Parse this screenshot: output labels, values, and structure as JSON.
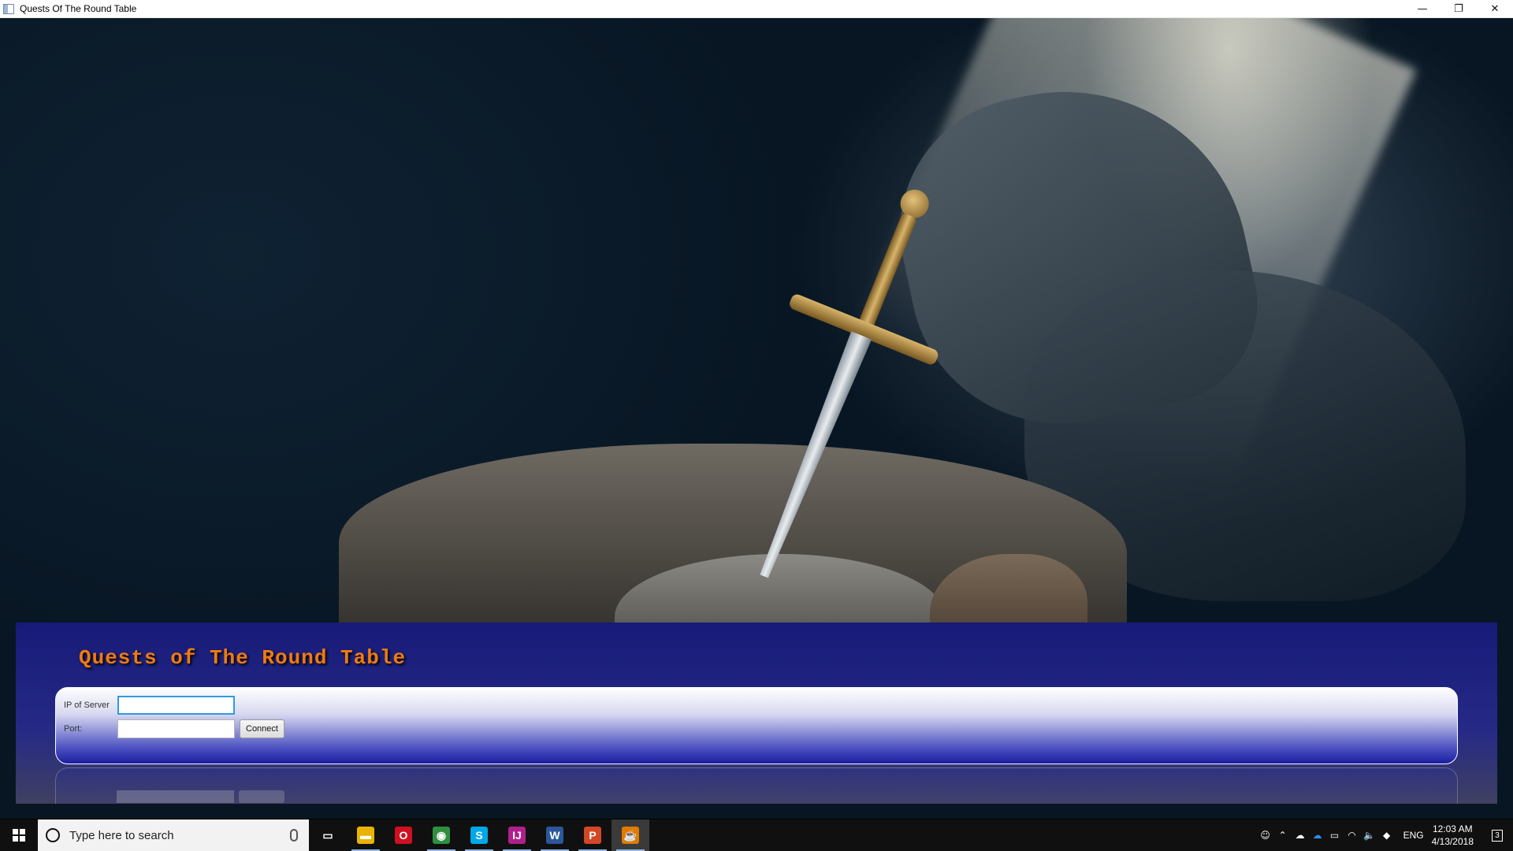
{
  "window": {
    "title": "Quests Of The Round Table",
    "controls": {
      "minimize": "—",
      "restore": "❐",
      "close": "✕"
    }
  },
  "game": {
    "title": "Quests of The Round Table",
    "ip_label": "IP of Server",
    "ip_value": "",
    "port_label": "Port:",
    "port_value": "",
    "connect_label": "Connect",
    "accent_color": "#f07a10",
    "panel_color": "#171a78"
  },
  "taskbar": {
    "search_placeholder": "Type here to search",
    "apps": [
      {
        "name": "task-view-icon",
        "glyph": "▭",
        "color": "#101010",
        "active": false
      },
      {
        "name": "file-explorer-icon",
        "glyph": "▬",
        "color": "#e8b400",
        "active": true
      },
      {
        "name": "opera-icon",
        "glyph": "O",
        "color": "#d01020",
        "active": false
      },
      {
        "name": "chrome-icon",
        "glyph": "◉",
        "color": "#2f8f3f",
        "active": true
      },
      {
        "name": "skype-icon",
        "glyph": "S",
        "color": "#00a8e8",
        "active": true
      },
      {
        "name": "intellij-icon",
        "glyph": "IJ",
        "color": "#b0208a",
        "active": true
      },
      {
        "name": "word-icon",
        "glyph": "W",
        "color": "#2b579a",
        "active": true
      },
      {
        "name": "powerpoint-icon",
        "glyph": "P",
        "color": "#d24726",
        "active": true
      },
      {
        "name": "java-icon",
        "glyph": "☕",
        "color": "#e07b00",
        "active": true
      }
    ],
    "tray": {
      "language": "ENG",
      "time": "12:03 AM",
      "date": "4/13/2018",
      "notifications": "3"
    }
  }
}
